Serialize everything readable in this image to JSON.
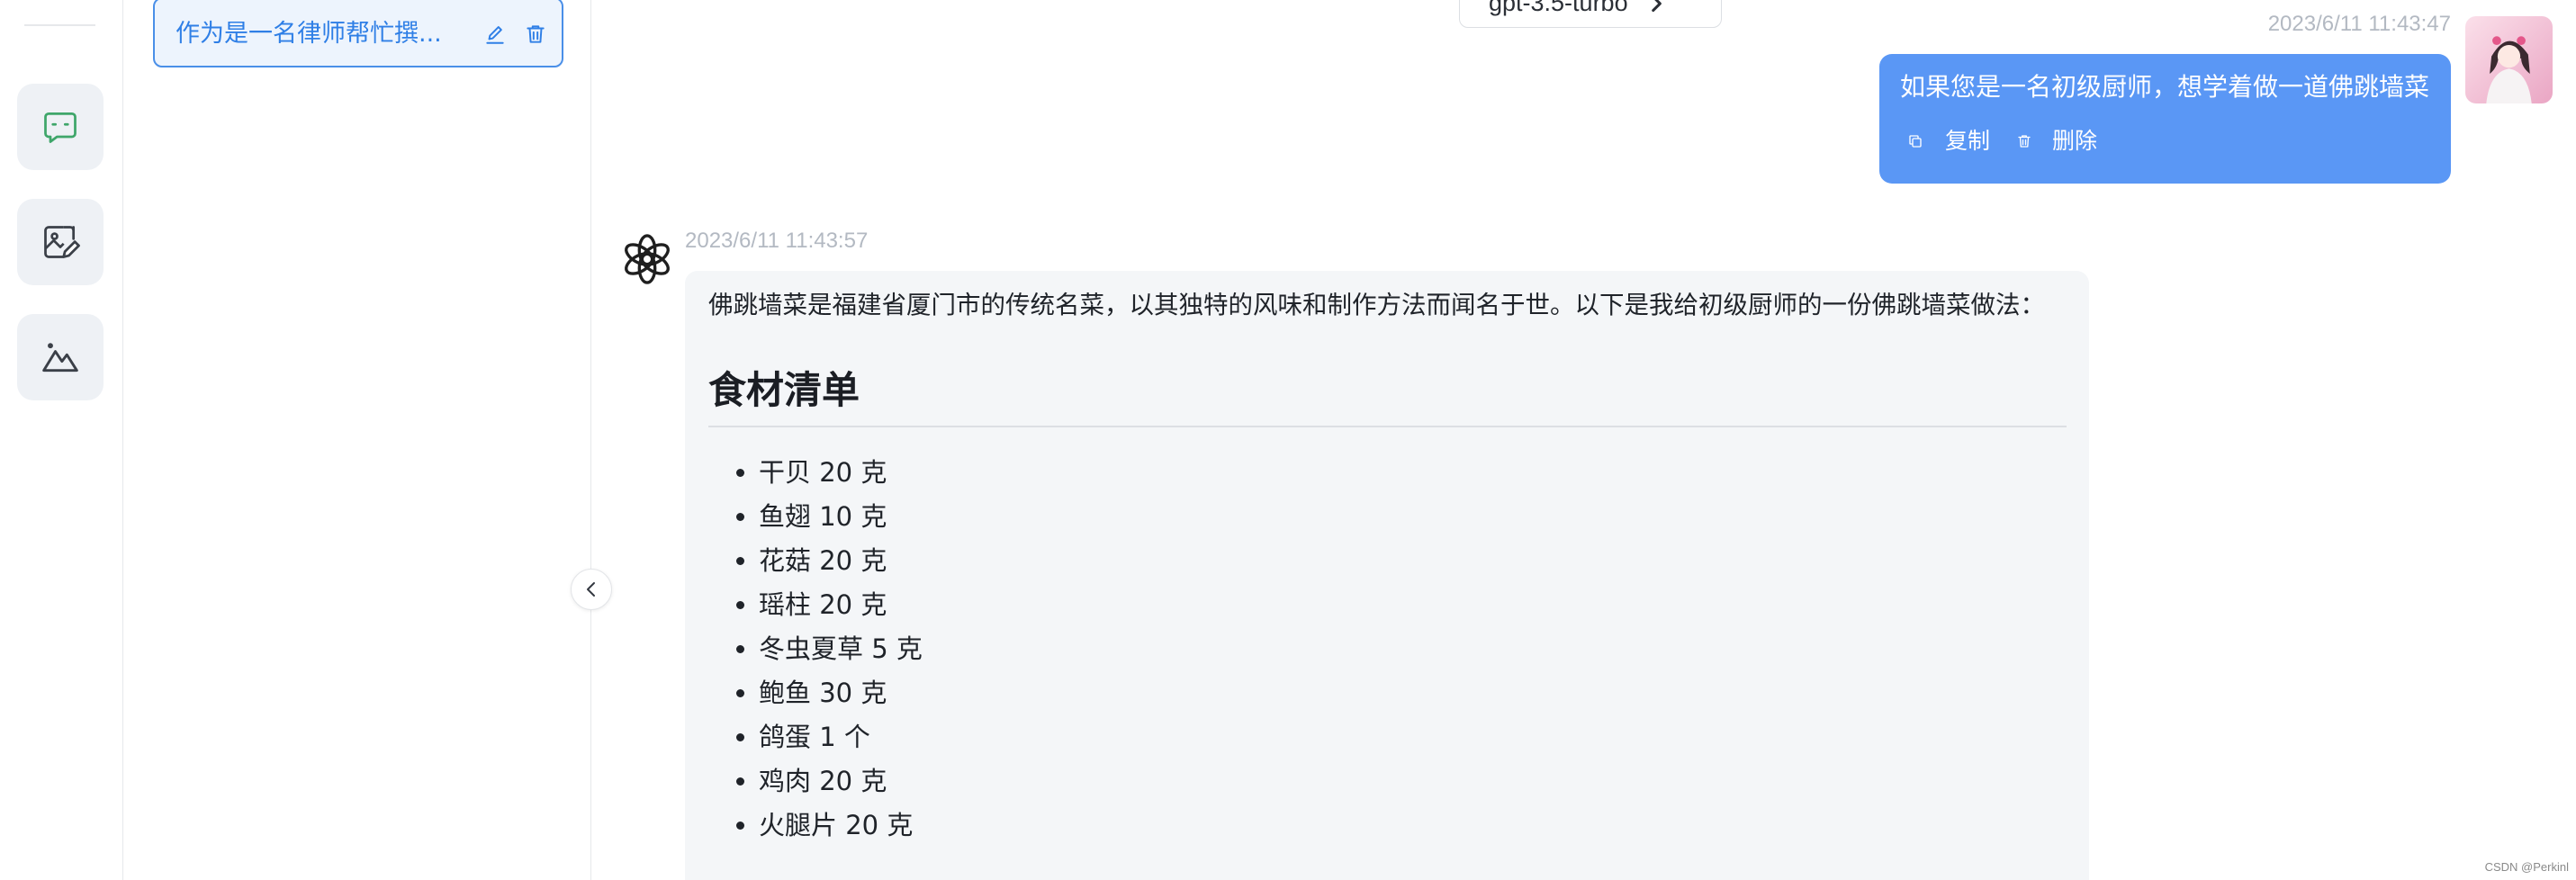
{
  "rail": {
    "items": [
      {
        "icon": "chat-bubble-icon",
        "active": true
      },
      {
        "icon": "image-edit-icon",
        "active": false
      },
      {
        "icon": "mountain-icon",
        "active": false
      }
    ]
  },
  "sessions": [
    {
      "title": "作为是一名律师帮忙撰...",
      "edit_icon": "edit-icon",
      "delete_icon": "trash-icon",
      "active": true
    }
  ],
  "sidebar_toggle": {
    "icon": "chevron-left-icon"
  },
  "header": {
    "model_selector": {
      "label": "gpt-3.5-turbo",
      "icon": "chevron-right-icon"
    }
  },
  "chat": {
    "user_message": {
      "timestamp": "2023/6/11 11:43:47",
      "text": "如果您是一名初级厨师，想学着做一道佛跳墙菜",
      "avatar_icon": "user-avatar",
      "actions": [
        {
          "label": "复制",
          "icon": "copy-icon"
        },
        {
          "label": "删除",
          "icon": "trash-icon"
        }
      ]
    },
    "assistant_message": {
      "timestamp": "2023/6/11 11:43:57",
      "avatar_icon": "openai-logo-icon",
      "intro": "佛跳墙菜是福建省厦门市的传统名菜，以其独特的风味和制作方法而闻名于世。以下是我给初级厨师的一份佛跳墙菜做法：",
      "heading": "食材清单",
      "ingredients": [
        "干贝 20 克",
        "鱼翅 10 克",
        "花菇 20 克",
        "瑶柱 20 克",
        "冬虫夏草 5 克",
        "鲍鱼 30 克",
        "鸽蛋 1 个",
        "鸡肉 20 克",
        "火腿片 20 克"
      ]
    }
  },
  "watermark": "CSDN @Perkinl",
  "colors": {
    "accent_blue": "#2f7fe6",
    "user_bubble": "#5a97f5",
    "assistant_bubble": "#f4f6f8",
    "chat_icon_green": "#3fa66a",
    "timestamp": "#b3b9c2"
  }
}
